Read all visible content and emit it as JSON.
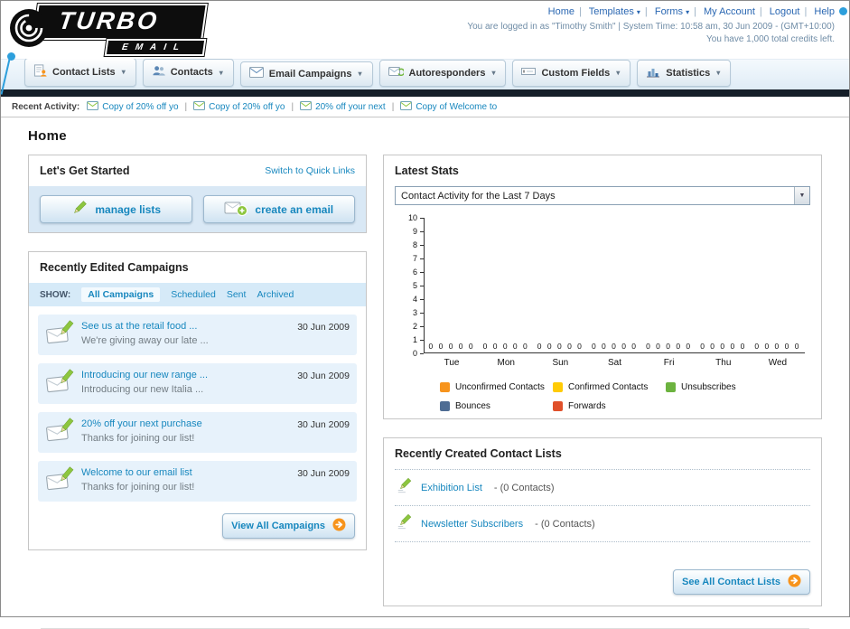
{
  "header": {
    "logo": {
      "line1": "TURBO",
      "line2": "EMAIL"
    },
    "links": [
      {
        "label": "Home"
      },
      {
        "label": "Templates"
      },
      {
        "label": "Forms"
      },
      {
        "label": "My Account"
      },
      {
        "label": "Logout"
      },
      {
        "label": "Help"
      }
    ],
    "login_info": "You are logged in as \"Timothy Smith\" | System Time: 10:58 am, 30 Jun 2009 - (GMT+10:00)",
    "credits": "You have 1,000 total credits left."
  },
  "nav": {
    "tabs": [
      {
        "label": "Contact Lists",
        "icon": "contact-lists-icon"
      },
      {
        "label": "Contacts",
        "icon": "contacts-icon"
      },
      {
        "label": "Email Campaigns",
        "icon": "email-campaigns-icon"
      },
      {
        "label": "Autoresponders",
        "icon": "autoresponders-icon"
      },
      {
        "label": "Custom Fields",
        "icon": "custom-fields-icon"
      },
      {
        "label": "Statistics",
        "icon": "statistics-icon"
      }
    ]
  },
  "recent_activity": {
    "label": "Recent Activity:",
    "items": [
      {
        "label": "Copy of 20% off yo"
      },
      {
        "label": "Copy of 20% off yo"
      },
      {
        "label": "20% off your next"
      },
      {
        "label": "Copy of Welcome to"
      }
    ]
  },
  "page_title": "Home",
  "get_started": {
    "title": "Let's Get Started",
    "switch_link": "Switch to Quick Links",
    "manage_lists_label": "manage lists",
    "create_email_label": "create an email"
  },
  "campaigns": {
    "title": "Recently Edited Campaigns",
    "show_label": "SHOW:",
    "filters": [
      {
        "label": "All Campaigns",
        "selected": true
      },
      {
        "label": "Scheduled",
        "selected": false
      },
      {
        "label": "Sent",
        "selected": false
      },
      {
        "label": "Archived",
        "selected": false
      }
    ],
    "items": [
      {
        "title": "See us at the retail food ...",
        "subtitle": "We're giving away our late ...",
        "date": "30 Jun 2009"
      },
      {
        "title": "Introducing our new range ...",
        "subtitle": "Introducing our new Italia ...",
        "date": "30 Jun 2009"
      },
      {
        "title": "20% off your next purchase",
        "subtitle": "Thanks for joining our list!",
        "date": "30 Jun 2009"
      },
      {
        "title": "Welcome to our email list",
        "subtitle": "Thanks for joining our list!",
        "date": "30 Jun 2009"
      }
    ],
    "view_all_label": "View All Campaigns"
  },
  "stats": {
    "title": "Latest Stats",
    "period_selected": "Contact Activity for the Last 7 Days",
    "chart_data": {
      "type": "bar",
      "title": "Contact Activity for the Last 7 Days",
      "categories": [
        "Tue",
        "Mon",
        "Sun",
        "Sat",
        "Fri",
        "Thu",
        "Wed"
      ],
      "series": [
        {
          "name": "Unconfirmed Contacts",
          "color": "#f7941d",
          "values": [
            0,
            0,
            0,
            0,
            0,
            0,
            0
          ]
        },
        {
          "name": "Confirmed Contacts",
          "color": "#ffcb05",
          "values": [
            0,
            0,
            0,
            0,
            0,
            0,
            0
          ]
        },
        {
          "name": "Unsubscribes",
          "color": "#6cb33f",
          "values": [
            0,
            0,
            0,
            0,
            0,
            0,
            0
          ]
        },
        {
          "name": "Bounces",
          "color": "#4f6d94",
          "values": [
            0,
            0,
            0,
            0,
            0,
            0,
            0
          ]
        },
        {
          "name": "Forwards",
          "color": "#e0502a",
          "values": [
            0,
            0,
            0,
            0,
            0,
            0,
            0
          ]
        }
      ],
      "ylim": [
        0,
        10
      ],
      "ytick_step": 1,
      "grid": false,
      "value_labels": true,
      "legend_position": "bottom"
    }
  },
  "contact_lists": {
    "title": "Recently Created Contact Lists",
    "items": [
      {
        "name": "Exhibition List",
        "detail": "- (0 Contacts)"
      },
      {
        "name": "Newsletter Subscribers",
        "detail": "- (0 Contacts)"
      }
    ],
    "see_all_label": "See All Contact Lists"
  }
}
